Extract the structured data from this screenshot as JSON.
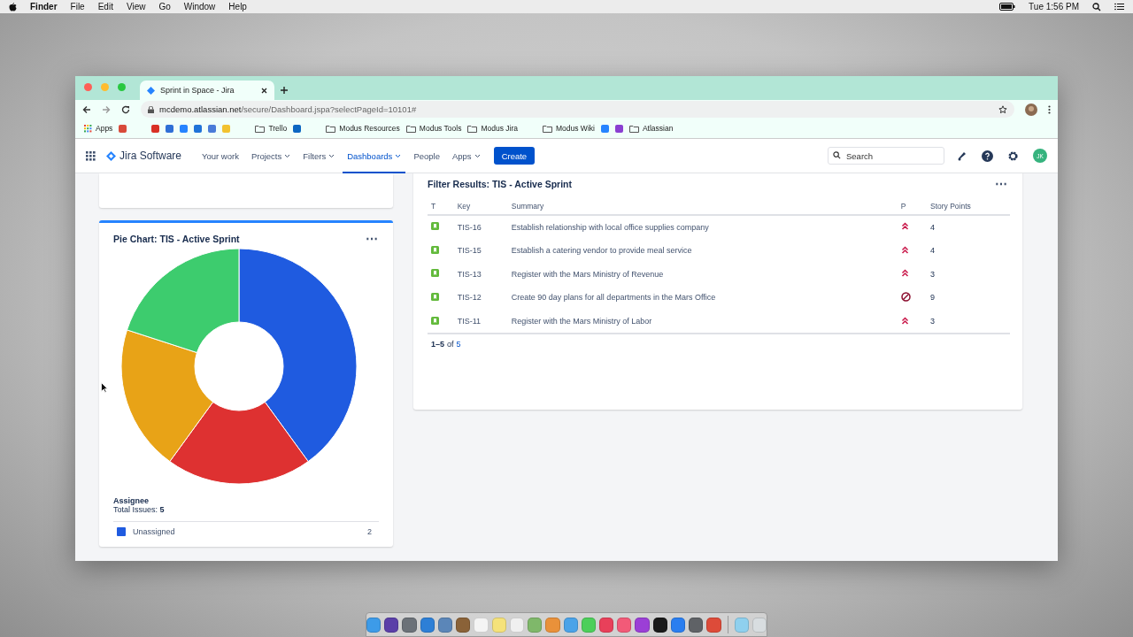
{
  "menubar": {
    "app": "Finder",
    "items": [
      "File",
      "Edit",
      "View",
      "Go",
      "Window",
      "Help"
    ],
    "clock": "Tue 1:56 PM"
  },
  "browser": {
    "tab_title": "Sprint in Space - Jira",
    "url_host": "mcdemo.atlassian.net",
    "url_path": "/secure/Dashboard.jspa?selectPageId=10101#",
    "bookmarks": [
      {
        "kind": "apps",
        "label": "Apps"
      },
      {
        "kind": "icon",
        "color": "#d84a3a"
      },
      {
        "kind": "sep"
      },
      {
        "kind": "icon",
        "color": "#d93025"
      },
      {
        "kind": "icon",
        "color": "#2f6fd6"
      },
      {
        "kind": "icon",
        "color": "#2684ff"
      },
      {
        "kind": "icon",
        "color": "#1f73d8"
      },
      {
        "kind": "icon",
        "color": "#4a7bd8"
      },
      {
        "kind": "icon",
        "color": "#f2c230"
      },
      {
        "kind": "sep"
      },
      {
        "kind": "folder",
        "label": "Trello"
      },
      {
        "kind": "icon",
        "color": "#0c66c2"
      },
      {
        "kind": "sep"
      },
      {
        "kind": "folder",
        "label": "Modus Resources"
      },
      {
        "kind": "folder",
        "label": "Modus Tools"
      },
      {
        "kind": "folder",
        "label": "Modus Jira"
      },
      {
        "kind": "sep"
      },
      {
        "kind": "folder",
        "label": "Modus Wiki"
      },
      {
        "kind": "icon",
        "color": "#2684ff"
      },
      {
        "kind": "icon",
        "color": "#8a3fd1"
      },
      {
        "kind": "folder",
        "label": "Atlassian"
      }
    ]
  },
  "jira": {
    "product": "Jira Software",
    "nav": [
      {
        "label": "Your work",
        "dropdown": false,
        "selected": false
      },
      {
        "label": "Projects",
        "dropdown": true,
        "selected": false
      },
      {
        "label": "Filters",
        "dropdown": true,
        "selected": false
      },
      {
        "label": "Dashboards",
        "dropdown": true,
        "selected": true
      },
      {
        "label": "People",
        "dropdown": false,
        "selected": false
      },
      {
        "label": "Apps",
        "dropdown": true,
        "selected": false
      }
    ],
    "create": "Create",
    "search": {
      "placeholder": "Search"
    },
    "avatar": "JK"
  },
  "pie_gadget": {
    "title": "Pie Chart: TIS - Active Sprint",
    "menu": "⋯",
    "chart_data": {
      "type": "donut",
      "series": [
        {
          "name": "Assignee",
          "values": [
            40,
            20,
            20,
            20
          ]
        }
      ]
    },
    "total": "Total Issues: **5**",
    "legend": [
      {
        "name": "Unassigned",
        "count": "2",
        "color": "#1f5be0"
      }
    ]
  },
  "filter_gadget": {
    "title": "Filter Results: TIS - Active Sprint",
    "menu": "⋯",
    "columns": [
      "T",
      "Key",
      "Summary",
      "P",
      "Story Points"
    ],
    "rows": [
      {
        "key": "TIS-16",
        "summary": "Establish relationship with local office supplies company",
        "kind": "highest",
        "points": "4"
      },
      {
        "key": "TIS-15",
        "summary": "Establish a catering vendor to provide meal service",
        "kind": "highest",
        "points": "4"
      },
      {
        "key": "TIS-13",
        "summary": "Register with the Mars Ministry of Revenue",
        "kind": "highest",
        "points": "3"
      },
      {
        "key": "TIS-12",
        "summary": "Create 90 day plans for all departments in the Mars Office",
        "kind": "blocker",
        "points": "9"
      },
      {
        "key": "TIS-11",
        "summary": "Register with the Mars Ministry of Labor",
        "kind": "highest",
        "points": "3"
      }
    ],
    "range": "1–5",
    "of": "of",
    "total": "5"
  },
  "dock": {
    "apps": [
      {
        "color": "#3d9be8"
      },
      {
        "color": "#5a3fa8"
      },
      {
        "color": "#6b7178"
      },
      {
        "color": "#2d7fd6"
      },
      {
        "color": "#5b86b8"
      },
      {
        "color": "#8a6238"
      },
      {
        "color": "#f4f4f4"
      },
      {
        "color": "#f5e27a"
      },
      {
        "color": "#f0f0f0"
      },
      {
        "color": "#7fb86a"
      },
      {
        "color": "#e9913a"
      },
      {
        "color": "#4aa3e8"
      },
      {
        "color": "#4ccf5a"
      },
      {
        "color": "#e8405a"
      },
      {
        "color": "#f25a78"
      },
      {
        "color": "#9b3fd6"
      },
      {
        "color": "#1a1a1a"
      },
      {
        "color": "#2a7ef0"
      },
      {
        "color": "#5f6266"
      },
      {
        "color": "#dd4b39"
      },
      {
        "kind": "sep"
      },
      {
        "color": "#8fd0ee"
      },
      {
        "color": "#d8dde0"
      }
    ]
  }
}
